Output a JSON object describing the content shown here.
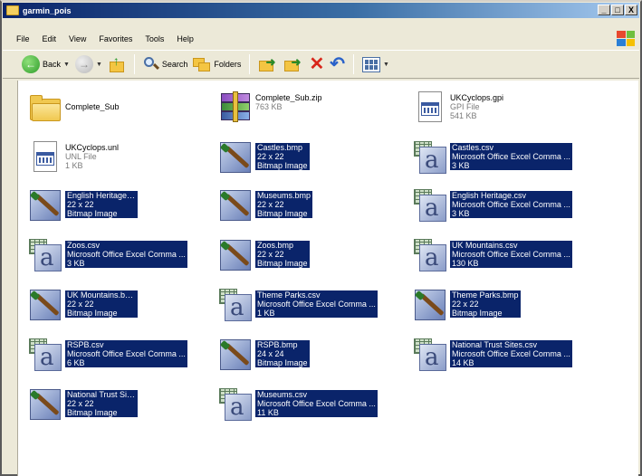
{
  "window": {
    "title": "garmin_pois",
    "controls": {
      "minimize": "_",
      "maximize": "□",
      "close": "X"
    }
  },
  "menu": [
    "File",
    "Edit",
    "View",
    "Favorites",
    "Tools",
    "Help"
  ],
  "toolbar": {
    "back": "Back",
    "search": "Search",
    "folders": "Folders"
  },
  "files": [
    {
      "name": "Complete_Sub",
      "type": "folder",
      "l2": "",
      "l3": "",
      "selected": false
    },
    {
      "name": "Complete_Sub.zip",
      "type": "zip",
      "l2": "763 KB",
      "l3": "",
      "selected": false
    },
    {
      "name": "UKCyclops.gpi",
      "type": "doc",
      "l2": "GPI File",
      "l3": "541 KB",
      "selected": false
    },
    {
      "name": "UKCyclops.unl",
      "type": "doc",
      "l2": "UNL File",
      "l3": "1 KB",
      "selected": false
    },
    {
      "name": "Castles.bmp",
      "type": "bmp",
      "l2": "22 x 22",
      "l3": "Bitmap Image",
      "selected": true
    },
    {
      "name": "Castles.csv",
      "type": "csv",
      "l2": "Microsoft Office Excel Comma ...",
      "l3": "3 KB",
      "selected": true
    },
    {
      "name": "English Heritage.bmp",
      "type": "bmp",
      "l2": "22 x 22",
      "l3": "Bitmap Image",
      "selected": true
    },
    {
      "name": "Museums.bmp",
      "type": "bmp",
      "l2": "22 x 22",
      "l3": "Bitmap Image",
      "selected": true
    },
    {
      "name": "English Heritage.csv",
      "type": "csv",
      "l2": "Microsoft Office Excel Comma ...",
      "l3": "3 KB",
      "selected": true
    },
    {
      "name": "Zoos.csv",
      "type": "csv",
      "l2": "Microsoft Office Excel Comma ...",
      "l3": "3 KB",
      "selected": true
    },
    {
      "name": "Zoos.bmp",
      "type": "bmp",
      "l2": "22 x 22",
      "l3": "Bitmap Image",
      "selected": true
    },
    {
      "name": "UK Mountains.csv",
      "type": "csv",
      "l2": "Microsoft Office Excel Comma ...",
      "l3": "130 KB",
      "selected": true
    },
    {
      "name": "UK Mountains.bmp",
      "type": "bmp",
      "l2": "22 x 22",
      "l3": "Bitmap Image",
      "selected": true
    },
    {
      "name": "Theme Parks.csv",
      "type": "csv",
      "l2": "Microsoft Office Excel Comma ...",
      "l3": "1 KB",
      "selected": true
    },
    {
      "name": "Theme Parks.bmp",
      "type": "bmp",
      "l2": "22 x 22",
      "l3": "Bitmap Image",
      "selected": true
    },
    {
      "name": "RSPB.csv",
      "type": "csv",
      "l2": "Microsoft Office Excel Comma ...",
      "l3": "6 KB",
      "selected": true
    },
    {
      "name": "RSPB.bmp",
      "type": "bmp",
      "l2": "24 x 24",
      "l3": "Bitmap Image",
      "selected": true
    },
    {
      "name": "National Trust Sites.csv",
      "type": "csv",
      "l2": "Microsoft Office Excel Comma ...",
      "l3": "14 KB",
      "selected": true
    },
    {
      "name": "National Trust Sites.bmp",
      "type": "bmp",
      "l2": "22 x 22",
      "l3": "Bitmap Image",
      "selected": true
    },
    {
      "name": "Museums.csv",
      "type": "csv",
      "l2": "Microsoft Office Excel Comma ...",
      "l3": "11 KB",
      "selected": true
    }
  ]
}
